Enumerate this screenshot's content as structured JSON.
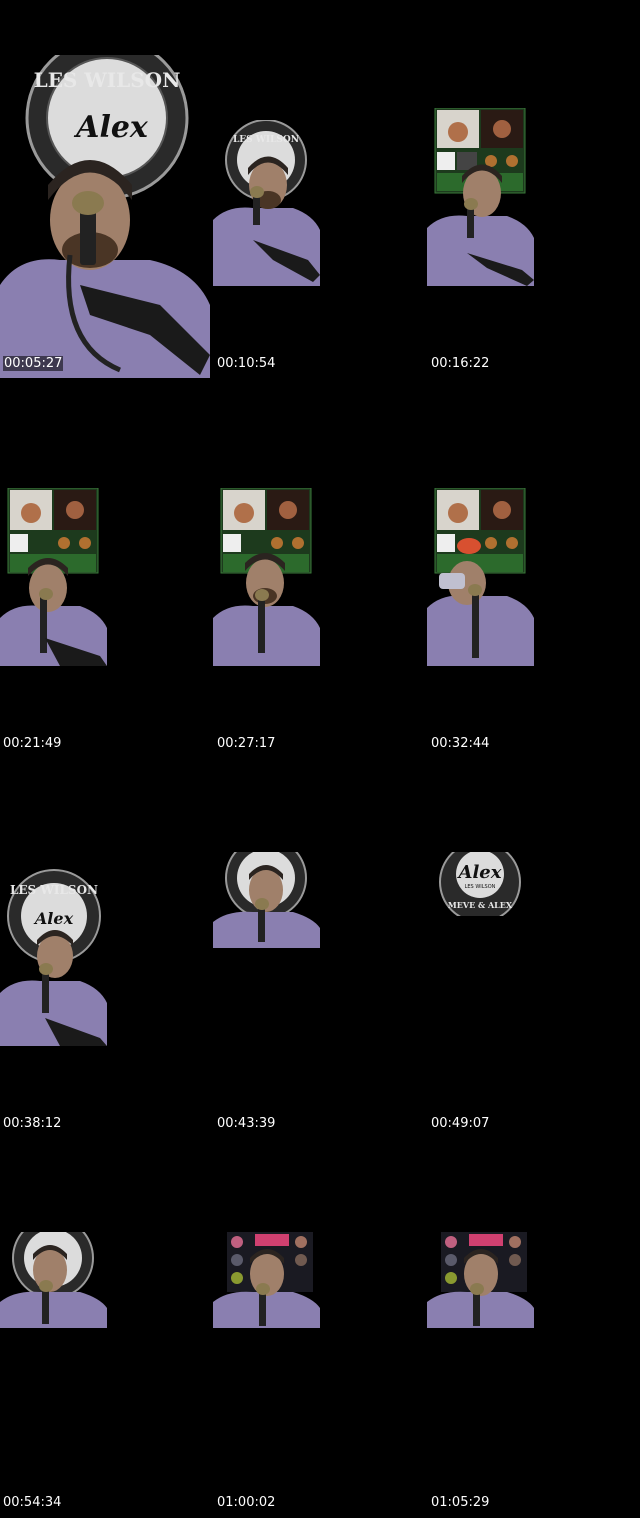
{
  "sheet": {
    "background": "#000000",
    "text_color": "#ffffff"
  },
  "branding": {
    "ring_text_top": "LES WILSON",
    "ring_text_bottom": "MEVE & ALEX",
    "script_text": "Alex",
    "small_caption": "LES WILSON",
    "icon": "podcast-seal-logo"
  },
  "frames": [
    {
      "timestamp": "00:05:27",
      "scene": "host-closeup-with-logo"
    },
    {
      "timestamp": "00:10:54",
      "scene": "host-with-logo"
    },
    {
      "timestamp": "00:16:22",
      "scene": "host-with-call-grid"
    },
    {
      "timestamp": "00:21:49",
      "scene": "host-with-call-grid"
    },
    {
      "timestamp": "00:27:17",
      "scene": "host-with-call-grid"
    },
    {
      "timestamp": "00:32:44",
      "scene": "host-drinking-with-call-grid"
    },
    {
      "timestamp": "00:38:12",
      "scene": "host-with-logo"
    },
    {
      "timestamp": "00:43:39",
      "scene": "host-with-logo"
    },
    {
      "timestamp": "00:49:07",
      "scene": "logo-only"
    },
    {
      "timestamp": "00:54:34",
      "scene": "host-with-logo"
    },
    {
      "timestamp": "01:00:02",
      "scene": "host-with-app-grid"
    },
    {
      "timestamp": "01:05:29",
      "scene": "host-with-app-grid"
    }
  ]
}
